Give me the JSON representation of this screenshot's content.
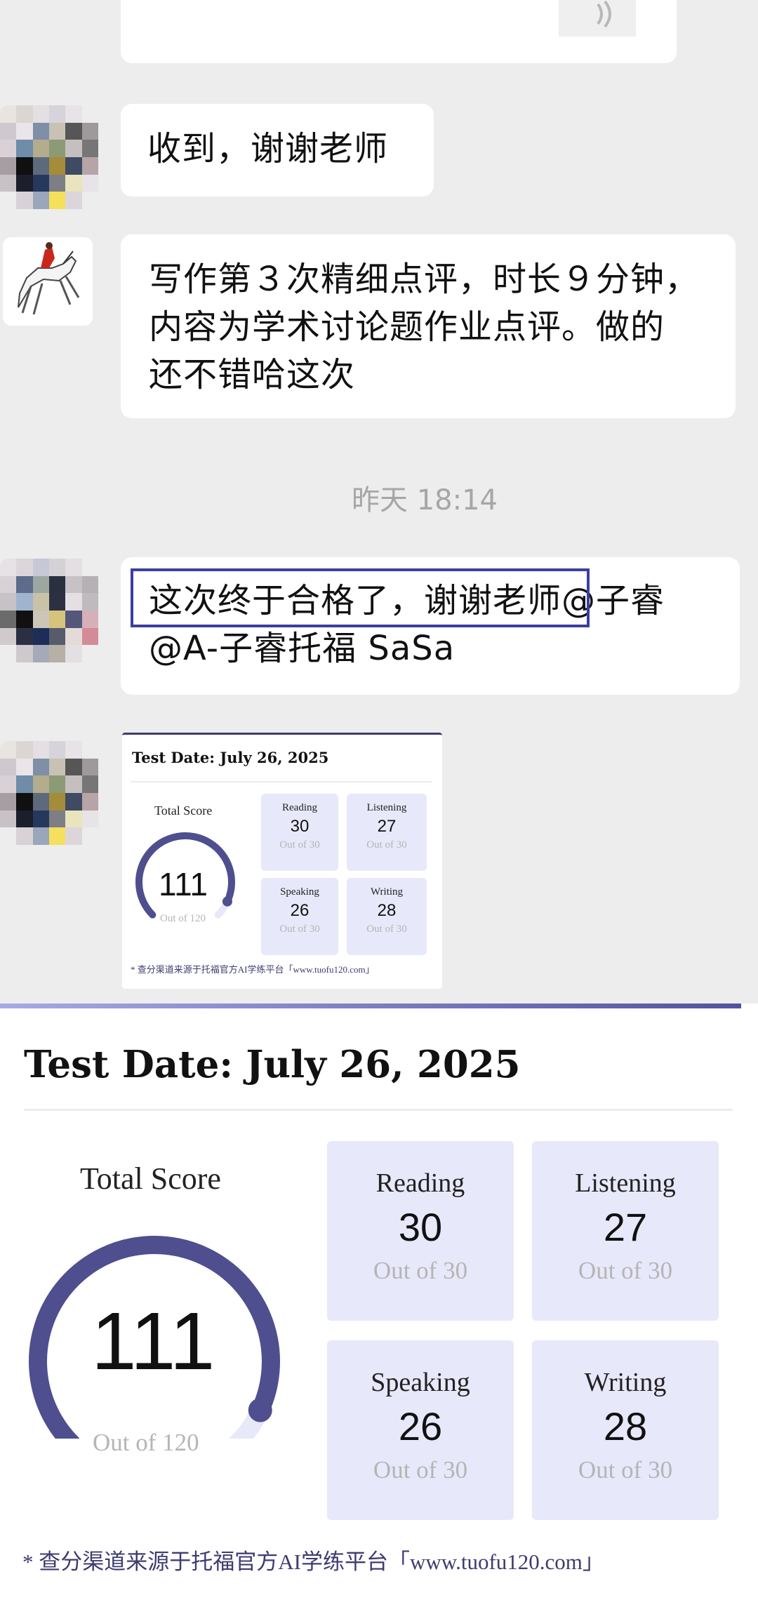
{
  "chat": {
    "top_file": {
      "size_text": ""
    },
    "messages": [
      {
        "id": "m1",
        "text": "收到，谢谢老师"
      },
      {
        "id": "m2",
        "lines": [
          "写作第３次精细点评，时长９分钟，",
          "内容为学术讨论题作业点评。做的",
          "还不错哈这次"
        ]
      },
      {
        "id": "m3",
        "line1_highlight": "这次终于合格了，谢谢老师",
        "line1_rest": "@子睿",
        "line2": "@A-子睿托福 SaSa"
      }
    ],
    "timestamp": "昨天 18:14"
  },
  "score_card": {
    "test_date": "Test Date: July 26, 2025",
    "total_label": "Total Score",
    "total_value": "111",
    "total_out_of": "Out of 120",
    "total_fraction": 0.925,
    "sections": [
      {
        "label": "Reading",
        "value": "30",
        "out_of": "Out of 30"
      },
      {
        "label": "Listening",
        "value": "27",
        "out_of": "Out of 30"
      },
      {
        "label": "Speaking",
        "value": "26",
        "out_of": "Out of 30"
      },
      {
        "label": "Writing",
        "value": "28",
        "out_of": "Out of 30"
      }
    ],
    "footer": "* 查分渠道来源于托福官方AI学练平台「www.tuofu120.com」"
  },
  "colors": {
    "chat_bg": "#ededed",
    "bubble": "#ffffff",
    "gauge": "#4f4e8e",
    "gauge_track": "#e8e8fb",
    "tile_bg": "#e8e8fb",
    "highlight_border": "#3b3fa0"
  }
}
